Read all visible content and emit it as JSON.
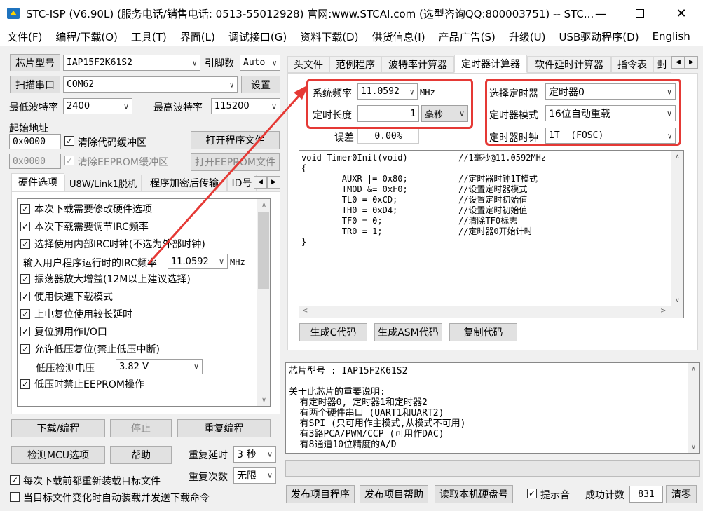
{
  "titlebar": {
    "title": "STC-ISP (V6.90L) (服务电话/销售电话: 0513-55012928) 官网:www.STCAI.com  (选型咨询QQ:800003751) -- STC..."
  },
  "menu": [
    "文件(F)",
    "编程/下载(O)",
    "工具(T)",
    "界面(L)",
    "调试接口(G)",
    "资料下载(D)",
    "供货信息(I)",
    "产品广告(S)",
    "升级(U)",
    "USB驱动程序(D)",
    "English"
  ],
  "left": {
    "chip_btn": "芯片型号",
    "chip_value": "IAP15F2K61S2",
    "pin_label": "引脚数",
    "pin_value": "Auto",
    "scan_btn": "扫描串口",
    "port_value": "COM62",
    "settings_btn": "设置",
    "min_baud_label": "最低波特率",
    "min_baud": "2400",
    "max_baud_label": "最高波特率",
    "max_baud": "115200",
    "start_addr_label": "起始地址",
    "addr1": "0x0000",
    "clear_code": "清除代码缓冲区",
    "open_prog": "打开程序文件",
    "addr2": "0x0000",
    "clear_eeprom": "清除EEPROM缓冲区",
    "open_eeprom": "打开EEPROM文件",
    "tabs": [
      "硬件选项",
      "U8W/Link1脱机",
      "程序加密后传输",
      "ID号"
    ],
    "hw_options": [
      "本次下载需要修改硬件选项",
      "本次下载需要调节IRC频率",
      "选择使用内部IRC时钟(不选为外部时钟)"
    ],
    "irc_label": "输入用户程序运行时的IRC频率",
    "irc_value": "11.0592",
    "irc_unit": "MHz",
    "hw_options2": [
      "振荡器放大增益(12M以上建议选择)",
      "使用快速下载模式",
      "上电复位使用较长延时",
      "复位脚用作I/O口",
      "允许低压复位(禁止低压中断)"
    ],
    "lv_label": "低压检测电压",
    "lv_value": "3.82 V",
    "hw_last": "低压时禁止EEPROM操作",
    "download_btn": "下载/编程",
    "stop_btn": "停止",
    "reprog_btn": "重复编程",
    "detect_btn": "检测MCU选项",
    "help_btn": "帮助",
    "repeat_delay_label": "重复延时",
    "repeat_delay": "3 秒",
    "repeat_count_label": "重复次数",
    "repeat_count": "无限",
    "reload_each": "每次下载前都重新装载目标文件",
    "auto_send": "当目标文件变化时自动装载并发送下载命令"
  },
  "right": {
    "tabs": [
      "头文件",
      "范例程序",
      "波特率计算器",
      "定时器计算器",
      "软件延时计算器",
      "指令表",
      "封"
    ],
    "sysfreq_label": "系统频率",
    "sysfreq": "11.0592",
    "sysfreq_unit": "MHz",
    "timer_len_label": "定时长度",
    "timer_len": "1",
    "timer_unit": "毫秒",
    "error_label": "误差",
    "error_value": "0.00%",
    "sel_timer_label": "选择定时器",
    "sel_timer": "定时器0",
    "timer_mode_label": "定时器模式",
    "timer_mode": "16位自动重载",
    "timer_clk_label": "定时器时钟",
    "timer_clk": "1T  (FOSC)",
    "code": [
      "void Timer0Init(void)          //1毫秒@11.0592MHz",
      "{",
      "        AUXR |= 0x80;          //定时器时钟1T模式",
      "        TMOD &= 0xF0;          //设置定时器模式",
      "        TL0 = 0xCD;            //设置定时初始值",
      "        TH0 = 0xD4;            //设置定时初始值",
      "        TF0 = 0;               //清除TF0标志",
      "        TR0 = 1;               //定时器0开始计时",
      "}"
    ],
    "gen_c": "生成C代码",
    "gen_asm": "生成ASM代码",
    "copy_code": "复制代码",
    "info": [
      "芯片型号 : IAP15F2K61S2",
      "",
      "关于此芯片的重要说明:",
      "  有定时器0, 定时器1和定时器2",
      "  有两个硬件串口 (UART1和UART2)",
      "  有SPI (只可用作主模式,从模式不可用)",
      "  有3路PCA/PWM/CCP (可用作DAC)",
      "  有8通道10位精度的A/D"
    ],
    "pub_prog": "发布项目程序",
    "pub_help": "发布项目帮助",
    "read_disk": "读取本机硬盘号",
    "beep": "提示音",
    "success_label": "成功计数",
    "success_count": "831",
    "clear_btn": "清零"
  },
  "colors": {
    "annotation": "#e53935"
  }
}
